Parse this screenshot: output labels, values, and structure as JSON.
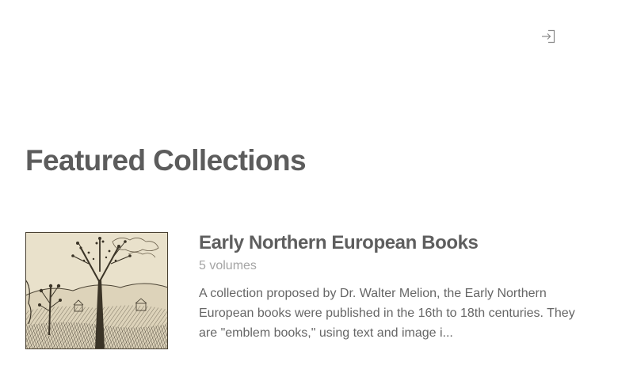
{
  "header": {
    "login_icon": "sign-in-icon"
  },
  "featured": {
    "title": "Featured Collections",
    "collections": [
      {
        "title": "Early Northern European Books",
        "count": "5 volumes",
        "description": "A collection proposed by Dr. Walter Melion, the Early Northern European books were published in the 16th to 18th centuries. They are \"emblem books,\" using text and image i...",
        "thumbnail": "woodcut-tree-landscape"
      }
    ]
  },
  "colors": {
    "title": "#5c5c5c",
    "muted": "#a4a4a4",
    "body": "#666666"
  }
}
